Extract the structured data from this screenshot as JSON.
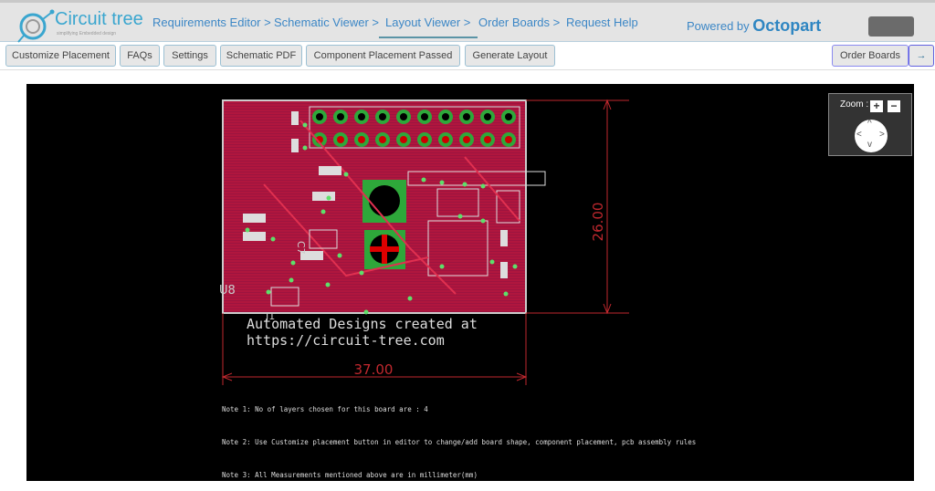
{
  "header": {
    "logo_title": "Circuit tree",
    "logo_tagline": "simplifying Embedded design",
    "nav": [
      "Requirements Editor >",
      "Schematic Viewer >",
      "Layout Viewer >",
      "Order Boards >",
      "Request Help"
    ],
    "powered_by": "Powered by",
    "powered_brand": "Octopart"
  },
  "toolbar": {
    "buttons": [
      "Customize Placement",
      "FAQs",
      "Settings",
      "Schematic PDF",
      "Component Placement Passed",
      "Generate Layout"
    ],
    "order_boards": "Order Boards",
    "arrow": "→"
  },
  "viewer": {
    "zoom_label": "Zoom :",
    "zoom_in": "+",
    "zoom_out": "−",
    "board_text_line1": "Automated Designs created at",
    "board_text_line2": "https://circuit-tree.com",
    "width_dim": "37.00",
    "height_dim": "26.00",
    "ref_u8": "U8",
    "ref_j1": "J1",
    "ref_c7": "C7",
    "notes": [
      "Note 1: No of layers chosen for this board are : 4",
      "Note 2: Use Customize placement button in editor to change/add board shape, component placement, pcb assembly rules",
      "Note 3: All Measurements mentioned above are in millimeter(mm)"
    ]
  },
  "colors": {
    "accent": "#3c87c6",
    "board": "#b0163e",
    "pad": "#2ea83a",
    "dimension": "#c0282e"
  }
}
